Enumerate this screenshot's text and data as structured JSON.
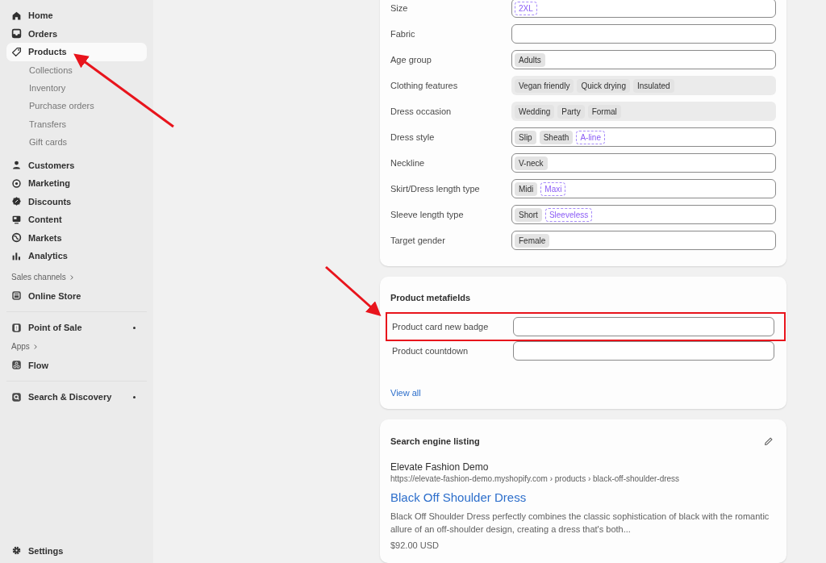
{
  "sidebar": {
    "items": [
      {
        "label": "Home",
        "selected": false
      },
      {
        "label": "Orders",
        "selected": false
      },
      {
        "label": "Products",
        "selected": true,
        "children": [
          {
            "label": "Collections"
          },
          {
            "label": "Inventory"
          },
          {
            "label": "Purchase orders"
          },
          {
            "label": "Transfers"
          },
          {
            "label": "Gift cards"
          }
        ]
      },
      {
        "label": "Customers",
        "selected": false
      },
      {
        "label": "Marketing",
        "selected": false
      },
      {
        "label": "Discounts",
        "selected": false
      },
      {
        "label": "Content",
        "selected": false
      },
      {
        "label": "Markets",
        "selected": false
      },
      {
        "label": "Analytics",
        "selected": false
      }
    ],
    "sales_channels": {
      "heading": "Sales channels",
      "items": [
        {
          "label": "Online Store",
          "dot": false
        },
        {
          "label": "Point of Sale",
          "dot": true
        }
      ]
    },
    "apps": {
      "heading": "Apps",
      "items": [
        {
          "label": "Flow",
          "dot": false
        },
        {
          "label": "Search & Discovery",
          "dot": true
        }
      ]
    },
    "settings": {
      "label": "Settings"
    }
  },
  "attributes": {
    "rows": [
      {
        "label": "Size",
        "disabled": false,
        "values": [
          {
            "text": "2XL",
            "kind": "suggested"
          }
        ]
      },
      {
        "label": "Fabric",
        "disabled": false,
        "values": []
      },
      {
        "label": "Age group",
        "disabled": false,
        "values": [
          {
            "text": "Adults",
            "kind": "chip"
          }
        ]
      },
      {
        "label": "Clothing features",
        "disabled": true,
        "values": [
          {
            "text": "Vegan friendly",
            "kind": "chip"
          },
          {
            "text": "Quick drying",
            "kind": "chip"
          },
          {
            "text": "Insulated",
            "kind": "chip"
          }
        ]
      },
      {
        "label": "Dress occasion",
        "disabled": true,
        "values": [
          {
            "text": "Wedding",
            "kind": "chip"
          },
          {
            "text": "Party",
            "kind": "chip"
          },
          {
            "text": "Formal",
            "kind": "chip"
          }
        ]
      },
      {
        "label": "Dress style",
        "disabled": false,
        "values": [
          {
            "text": "Slip",
            "kind": "chip"
          },
          {
            "text": "Sheath",
            "kind": "chip"
          },
          {
            "text": "A-line",
            "kind": "suggested"
          }
        ]
      },
      {
        "label": "Neckline",
        "disabled": false,
        "values": [
          {
            "text": "V-neck",
            "kind": "chip"
          }
        ]
      },
      {
        "label": "Skirt/Dress length type",
        "disabled": false,
        "values": [
          {
            "text": "Midi",
            "kind": "chip"
          },
          {
            "text": "Maxi",
            "kind": "suggested"
          }
        ]
      },
      {
        "label": "Sleeve length type",
        "disabled": false,
        "values": [
          {
            "text": "Short",
            "kind": "chip"
          },
          {
            "text": "Sleeveless",
            "kind": "suggested"
          }
        ]
      },
      {
        "label": "Target gender",
        "disabled": false,
        "values": [
          {
            "text": "Female",
            "kind": "chip"
          }
        ]
      }
    ]
  },
  "metafields": {
    "title": "Product metafields",
    "rows": [
      {
        "label": "Product card new badge",
        "highlighted": true
      },
      {
        "label": "Product countdown",
        "highlighted": false
      }
    ],
    "link": "View all"
  },
  "seo": {
    "title": "Search engine listing",
    "store_name": "Elevate Fashion Demo",
    "url": "https://elevate-fashion-demo.myshopify.com › products › black-off-shoulder-dress",
    "page_title": "Black Off Shoulder Dress",
    "description": "Black Off Shoulder Dress perfectly combines the classic sophistication of black with the romantic allure of an off-shoulder design, creating a dress that's both...",
    "price": "$92.00 USD"
  }
}
